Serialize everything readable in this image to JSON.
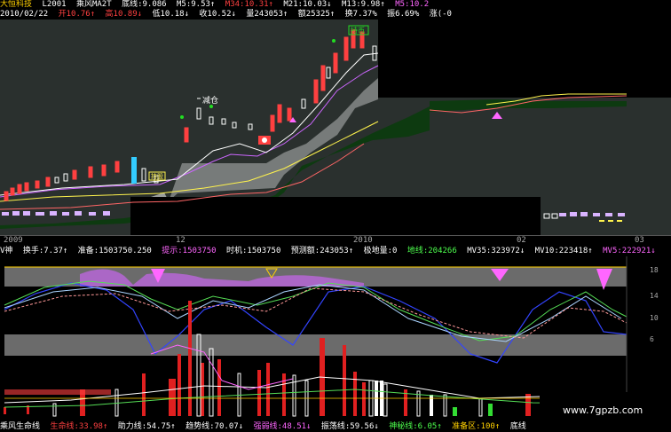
{
  "header": {
    "line1": [
      {
        "text": "大恒科技",
        "color": "#ffd000"
      },
      {
        "text": "L2001",
        "color": "#ffffff"
      },
      {
        "text": "乘风MA2T",
        "color": "#ffffff"
      },
      {
        "text": "底线:9.086",
        "color": "#ffffff"
      },
      {
        "text": "M5:9.53↑",
        "color": "#ffffff"
      },
      {
        "text": "M34:10.31↑",
        "color": "#ff4040"
      },
      {
        "text": "M21:10.03↓",
        "color": "#ffffff"
      },
      {
        "text": "M13:9.98↑",
        "color": "#ffffff"
      },
      {
        "text": "M5:10.2",
        "color": "#ff66ff"
      }
    ],
    "line2": [
      {
        "text": "2010/02/22",
        "color": "#ffffff"
      },
      {
        "text": "开10.76↑",
        "color": "#ff4040"
      },
      {
        "text": "高10.89↓",
        "color": "#ff4040"
      },
      {
        "text": "低10.18↓",
        "color": "#ffffff"
      },
      {
        "text": "收10.52↓",
        "color": "#ffffff"
      },
      {
        "text": "量243053↑",
        "color": "#ffffff"
      },
      {
        "text": "额25325↑",
        "color": "#ffffff"
      },
      {
        "text": "换7.37%",
        "color": "#ffffff"
      },
      {
        "text": "振6.69%",
        "color": "#ffffff"
      },
      {
        "text": "涨(-0",
        "color": "#ffffff"
      }
    ]
  },
  "chart_labels": {
    "reduce": "减仓",
    "top_box": "持币",
    "small_box": "持股"
  },
  "time_axis": [
    {
      "label": "2009",
      "pos": "left"
    },
    {
      "label": "12",
      "pos": "a"
    },
    {
      "label": "2010",
      "pos": "b"
    },
    {
      "label": "02",
      "pos": "c"
    },
    {
      "label": "03",
      "pos": "right"
    }
  ],
  "indicator_header": [
    {
      "text": "V神",
      "color": "#ffffff"
    },
    {
      "text": "换手:7.37↑",
      "color": "#ffffff"
    },
    {
      "text": "准备:1503750.250",
      "color": "#ffffff"
    },
    {
      "text": "提示:1503750",
      "color": "#ff66ff"
    },
    {
      "text": "时机:1503750",
      "color": "#ffffff"
    },
    {
      "text": "预测额:243053↑",
      "color": "#ffffff"
    },
    {
      "text": "极地量:0",
      "color": "#ffffff"
    },
    {
      "text": "地线:204266",
      "color": "#4dff4d"
    },
    {
      "text": "MV35:323972↓",
      "color": "#ffffff"
    },
    {
      "text": "MV10:223418↑",
      "color": "#ffffff"
    },
    {
      "text": "MV5:222921↓",
      "color": "#ff66ff"
    }
  ],
  "indicator_axis": [
    "18",
    "14",
    "10",
    "6"
  ],
  "footer": [
    {
      "text": "乘风生命线",
      "color": "#ffffff"
    },
    {
      "text": "生命线:33.98↑",
      "color": "#ff4040"
    },
    {
      "text": "助力线:54.75↑",
      "color": "#ffffff"
    },
    {
      "text": "趋势线:70.07↓",
      "color": "#ffffff"
    },
    {
      "text": "强弱线:48.51↓",
      "color": "#ff66ff"
    },
    {
      "text": "振荡线:59.56↓",
      "color": "#ffffff"
    },
    {
      "text": "神秘线:6.05↑",
      "color": "#4dff4d"
    },
    {
      "text": "准备区:100↑",
      "color": "#ffd000"
    },
    {
      "text": "底线",
      "color": "#ffffff"
    }
  ],
  "watermark": "www.7gpzb.com"
}
